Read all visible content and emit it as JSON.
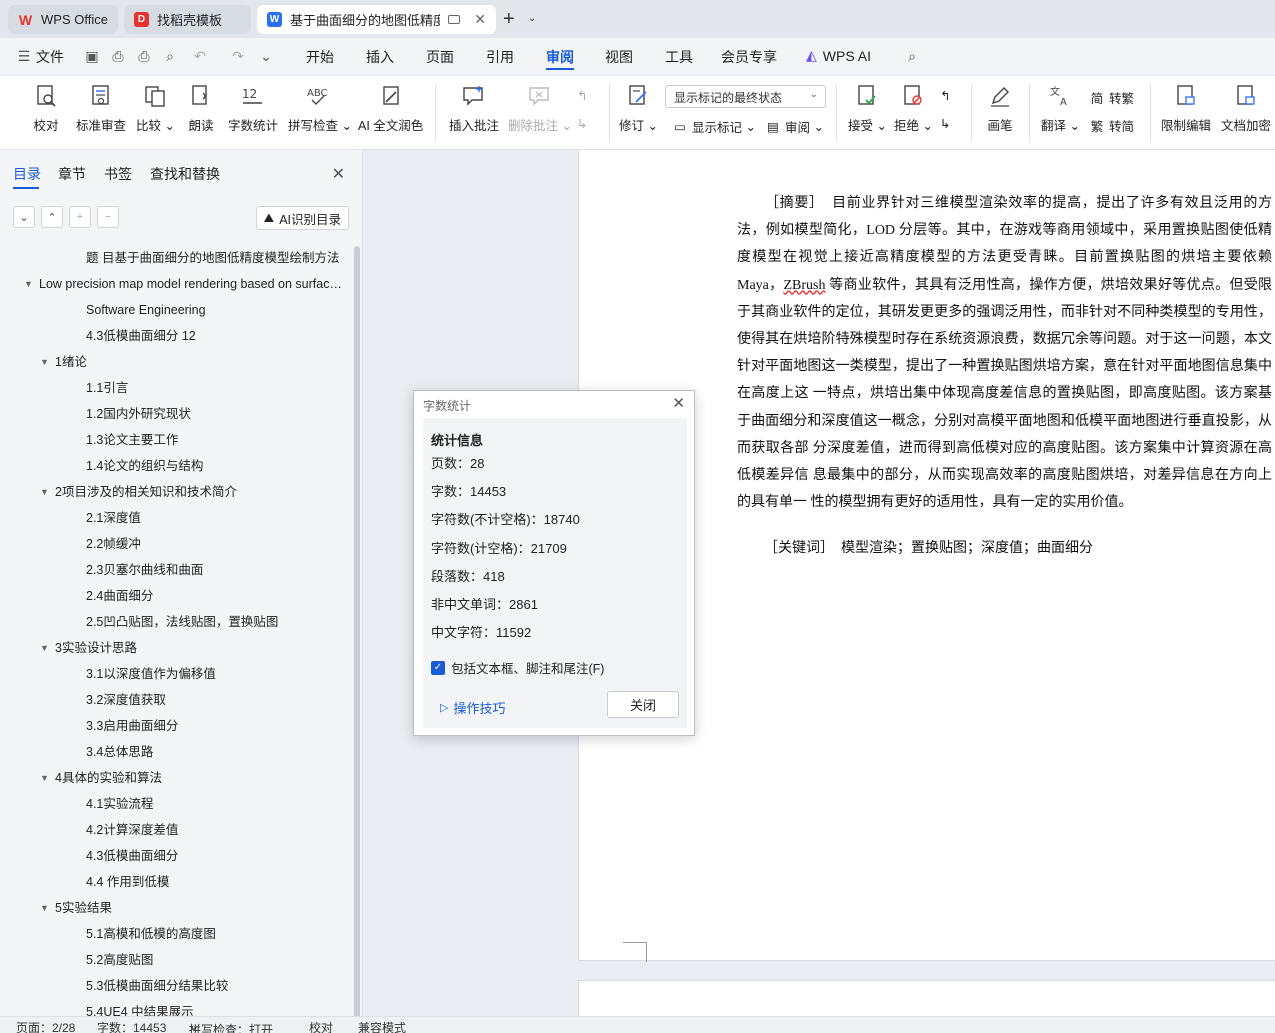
{
  "tabs": [
    {
      "label": "WPS Office",
      "icon": "wps-logo-icon"
    },
    {
      "label": "找稻壳模板",
      "icon": "docer-icon"
    },
    {
      "label": "基于曲面细分的地图低精度模",
      "icon": "word-doc-icon"
    }
  ],
  "menu": {
    "file": "文件",
    "items": [
      "开始",
      "插入",
      "页面",
      "引用",
      "审阅",
      "视图",
      "工具",
      "会员专享"
    ],
    "active": "审阅",
    "wps_ai": "WPS AI"
  },
  "ribbon": {
    "proofread": "校对",
    "standard_review": "标准审查",
    "compare": "比较",
    "read_aloud": "朗读",
    "word_count": "字数统计",
    "spell_check": "拼写检查",
    "ai_proofread": "AI 全文润色",
    "insert_comment": "插入批注",
    "delete_comment": "删除批注",
    "track_changes": "修订",
    "markup_combo": "显示标记的最终状态",
    "show_markup": "显示标记",
    "review_pane": "审阅",
    "accept": "接受",
    "reject": "拒绝",
    "pen": "画笔",
    "translate": "翻译",
    "to_traditional": "转繁",
    "to_simplified": "转简",
    "restrict_editing": "限制编辑",
    "encrypt": "文档加密"
  },
  "nav": {
    "tabs": [
      "目录",
      "章节",
      "书签",
      "查找和替换"
    ],
    "ai_toc": "AI识别目录",
    "toc": [
      {
        "label": "题 目基于曲面细分的地图低精度模型绘制方法",
        "level": 3,
        "arrow": ""
      },
      {
        "label": "Low precision map model rendering based on surface subdivision",
        "level": 1,
        "arrow": "▼"
      },
      {
        "label": "Software Engineering",
        "level": 3,
        "arrow": ""
      },
      {
        "label": "4.3低模曲面细分 12",
        "level": 3,
        "arrow": ""
      },
      {
        "label": "1绪论",
        "level": 2,
        "arrow": "▼"
      },
      {
        "label": "1.1引言",
        "level": 3,
        "arrow": ""
      },
      {
        "label": "1.2国内外研究现状",
        "level": 3,
        "arrow": ""
      },
      {
        "label": "1.3论文主要工作",
        "level": 3,
        "arrow": ""
      },
      {
        "label": "1.4论文的组织与结构",
        "level": 3,
        "arrow": ""
      },
      {
        "label": "2项目涉及的相关知识和技术简介",
        "level": 2,
        "arrow": "▼"
      },
      {
        "label": "2.1深度值",
        "level": 3,
        "arrow": ""
      },
      {
        "label": "2.2帧缓冲",
        "level": 3,
        "arrow": ""
      },
      {
        "label": "2.3贝塞尔曲线和曲面",
        "level": 3,
        "arrow": ""
      },
      {
        "label": "2.4曲面细分",
        "level": 3,
        "arrow": ""
      },
      {
        "label": "2.5凹凸贴图，法线贴图，置换贴图",
        "level": 3,
        "arrow": ""
      },
      {
        "label": "3实验设计思路",
        "level": 2,
        "arrow": "▼"
      },
      {
        "label": "3.1以深度值作为偏移值",
        "level": 3,
        "arrow": ""
      },
      {
        "label": "3.2深度值获取",
        "level": 3,
        "arrow": ""
      },
      {
        "label": "3.3启用曲面细分",
        "level": 3,
        "arrow": ""
      },
      {
        "label": "3.4总体思路",
        "level": 3,
        "arrow": ""
      },
      {
        "label": "4具体的实验和算法",
        "level": 2,
        "arrow": "▼"
      },
      {
        "label": "4.1实验流程",
        "level": 3,
        "arrow": ""
      },
      {
        "label": "4.2计算深度差值",
        "level": 3,
        "arrow": ""
      },
      {
        "label": "4.3低模曲面细分",
        "level": 3,
        "arrow": ""
      },
      {
        "label": "4.4 作用到低模",
        "level": 3,
        "arrow": ""
      },
      {
        "label": "5实验结果",
        "level": 2,
        "arrow": "▼"
      },
      {
        "label": "5.1高模和低模的高度图",
        "level": 3,
        "arrow": ""
      },
      {
        "label": "5.2高度贴图",
        "level": 3,
        "arrow": ""
      },
      {
        "label": "5.3低模曲面细分结果比较",
        "level": 3,
        "arrow": ""
      },
      {
        "label": "5.4UE4 中结果展示",
        "level": 3,
        "arrow": ""
      }
    ]
  },
  "document": {
    "abstract_label": "［摘要］",
    "abstract_part1": "目前业界针对三维模型渲染效率的提高，提出了许多有效且泛用的方法，例如模型简化，LOD 分层等。其中，在游戏等商用领域中，采用置换贴图使低精度模型在视觉上接近高精度模型的方法更受青睐。目前置换贴图的烘培主要依赖 Maya，",
    "abstract_spell": "ZBrush",
    "abstract_part2": " 等商业软件，其具有泛用性高，操作方便，烘培效果好等优点。但受限于其商业软件的定位，其研发更更多的强调泛用性，而非针对不同种类模型的专用性，使得其在烘培阶特殊模型时存在系统资源浪费，数据冗余等问题。对于这一问题，本文针对平面地图这一类模型，提出了一种置换贴图烘培方案，意在针对平面地图信息集中在高度上这 一特点，烘培出集中体现高度差信息的置换贴图，即高度贴图。该方案基于曲面细分和深度值这一概念，分别对高模平面地图和低模平面地图进行垂直投影，从而获取各部 分深度差值，进而得到高低模对应的高度贴图。该方案集中计算资源在高低模差异信 息最集中的部分，从而实现高效率的高度贴图烘培，对差异信息在方向上的具有单一 性的模型拥有更好的适用性，具有一定的实用价值。",
    "keywords": "［关键词］　模型渲染；置换贴图；深度值；曲面细分"
  },
  "dialog": {
    "title": "字数统计",
    "heading": "统计信息",
    "pages": "页数：28",
    "words": "字数：14453",
    "chars_no_space": "字符数(不计空格)：18740",
    "chars_with_space": "字符数(计空格)：21709",
    "paragraphs": "段落数：418",
    "non_cjk_words": "非中文单词：2861",
    "cjk_chars": "中文字符：11592",
    "include_label": "包括文本框、脚注和尾注(F)",
    "include_checked": true,
    "tips": "操作技巧",
    "close": "关闭"
  },
  "status": {
    "page": "页面：2/28",
    "words": "字数：14453",
    "spell": "拼写检查：打开",
    "proof": "校对",
    "compat": "兼容模式"
  },
  "colors": {
    "accent": "#1a5bd8",
    "wps_red": "#e8322f",
    "word_blue": "#2a6ef2"
  }
}
